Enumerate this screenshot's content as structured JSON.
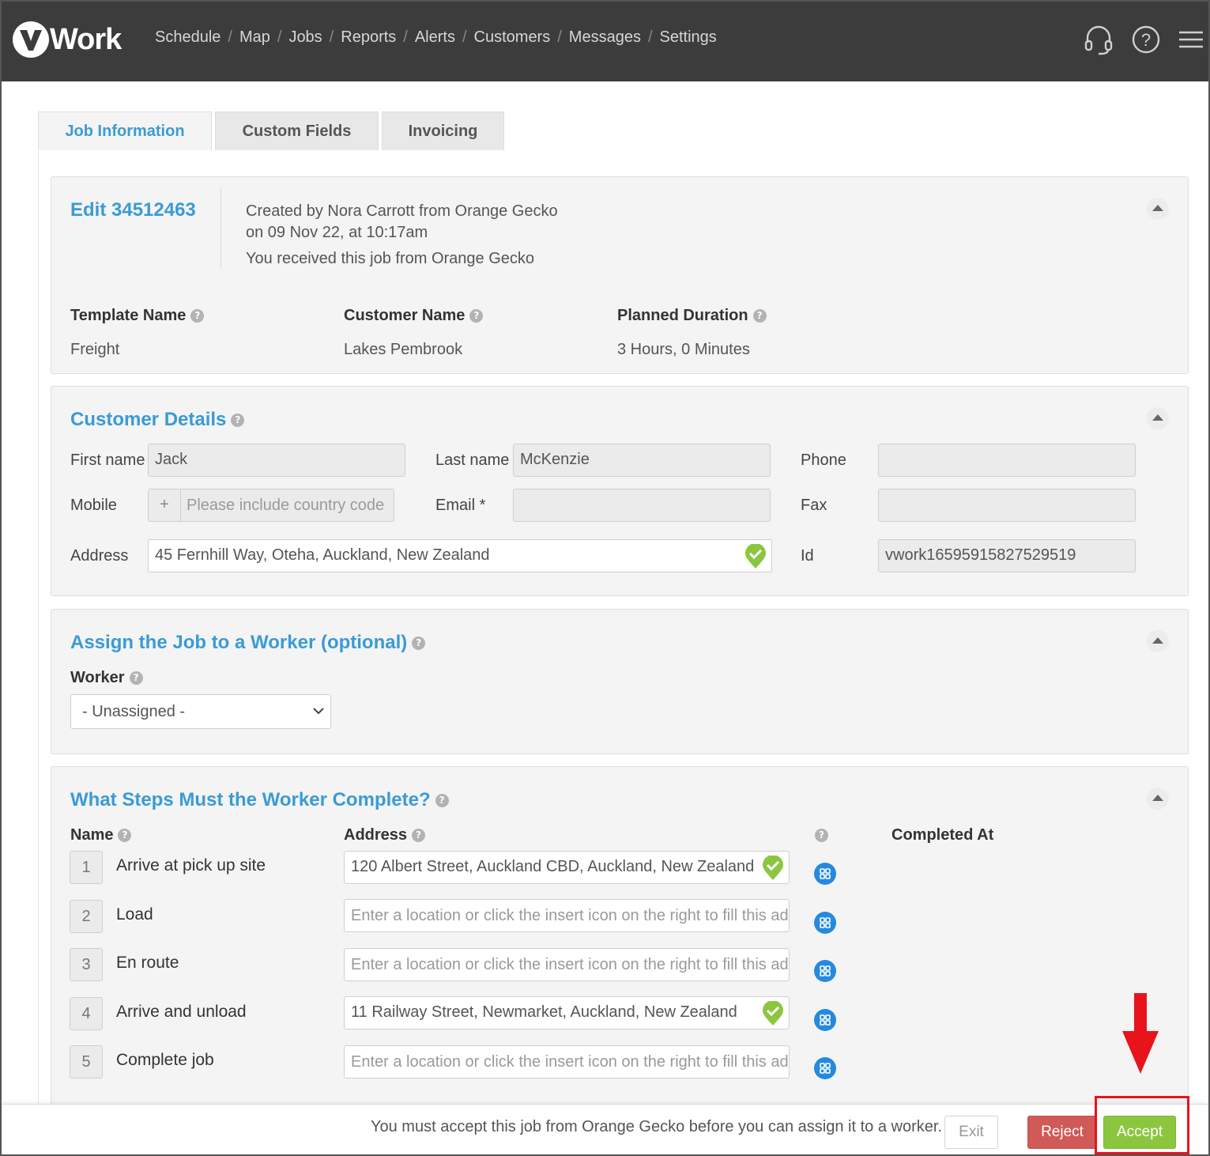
{
  "app": {
    "logo_text": "Work",
    "logo_letter": "v"
  },
  "nav": {
    "items": [
      "Schedule",
      "Map",
      "Jobs",
      "Reports",
      "Alerts",
      "Customers",
      "Messages",
      "Settings"
    ],
    "separator": "/",
    "icons": [
      "headset-icon",
      "help-icon",
      "menu-icon"
    ]
  },
  "tabs": [
    {
      "label": "Job Information",
      "active": true
    },
    {
      "label": "Custom Fields",
      "active": false
    },
    {
      "label": "Invoicing",
      "active": false
    }
  ],
  "job": {
    "edit_title": "Edit 34512463",
    "created_line1": "Created by Nora Carrott from Orange Gecko",
    "created_line2": "on 09 Nov 22, at 10:17am",
    "received_line": "You received this job from Orange Gecko",
    "template_label": "Template Name",
    "template_value": "Freight",
    "customer_label": "Customer Name",
    "customer_value": "Lakes Pembrook",
    "duration_label": "Planned Duration",
    "duration_value": "3 Hours, 0 Minutes"
  },
  "customer_details": {
    "title": "Customer Details",
    "first_name_label": "First name",
    "first_name_value": "Jack",
    "last_name_label": "Last name",
    "last_name_value": "McKenzie",
    "phone_label": "Phone",
    "phone_value": "",
    "mobile_label": "Mobile",
    "mobile_prefix": "+",
    "mobile_placeholder": "Please include country code",
    "email_label": "Email *",
    "email_value": "",
    "fax_label": "Fax",
    "fax_value": "",
    "address_label": "Address",
    "address_value": "45 Fernhill Way, Oteha, Auckland, New Zealand",
    "id_label": "Id",
    "id_value": "vwork16595915827529519"
  },
  "assign": {
    "title": "Assign the Job to a Worker (optional)",
    "worker_label": "Worker",
    "worker_selected": "- Unassigned -"
  },
  "steps": {
    "title": "What Steps Must the Worker Complete?",
    "col_name": "Name",
    "col_address": "Address",
    "col_completed": "Completed At",
    "address_placeholder": "Enter a location or click the insert icon on the right to fill this add",
    "rows": [
      {
        "num": "1",
        "name": "Arrive at pick up site",
        "address": "120 Albert Street, Auckland CBD, Auckland, New Zealand",
        "verified": true
      },
      {
        "num": "2",
        "name": "Load",
        "address": "",
        "verified": false
      },
      {
        "num": "3",
        "name": "En route",
        "address": "",
        "verified": false
      },
      {
        "num": "4",
        "name": "Arrive and unload",
        "address": "11 Railway Street, Newmarket, Auckland, New Zealand",
        "verified": true
      },
      {
        "num": "5",
        "name": "Complete job",
        "address": "",
        "verified": false
      }
    ]
  },
  "footer": {
    "message": "You must accept this job from Orange Gecko before you can assign it to a worker.",
    "exit_label": "Exit",
    "reject_label": "Reject",
    "accept_label": "Accept"
  },
  "colors": {
    "accent_blue": "#3a9bd5",
    "accept_green": "#8cc63f",
    "reject_red": "#cf5a58",
    "highlight_red": "#e8141c",
    "topbar": "#3c3c3c"
  }
}
